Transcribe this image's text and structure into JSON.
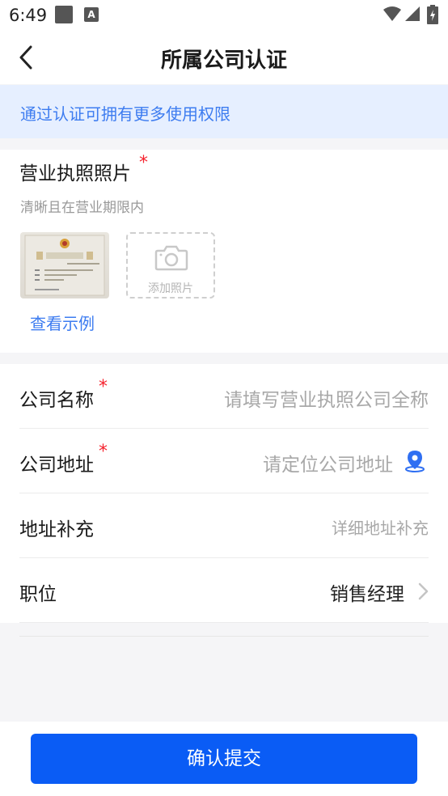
{
  "status": {
    "time": "6:49",
    "notif_letter": "A"
  },
  "header": {
    "title": "所属公司认证"
  },
  "notice": {
    "text": "通过认证可拥有更多使用权限"
  },
  "license": {
    "title": "营业执照照片",
    "required_mark": "*",
    "hint": "清晰且在营业期限内",
    "add_photo_label": "添加照片",
    "view_example": "查看示例"
  },
  "form": {
    "rows": [
      {
        "label": "公司名称",
        "required": "*",
        "value": "请填写营业执照公司全称"
      },
      {
        "label": "公司地址",
        "required": "*",
        "value": "请定位公司地址"
      },
      {
        "label": "地址补充",
        "value": "详细地址补充"
      },
      {
        "label": "职位",
        "value": "销售经理"
      }
    ]
  },
  "submit": {
    "label": "确认提交"
  },
  "colors": {
    "accent": "#0a5cf5",
    "notice_bg": "#e6efff",
    "required": "#f5222d"
  }
}
